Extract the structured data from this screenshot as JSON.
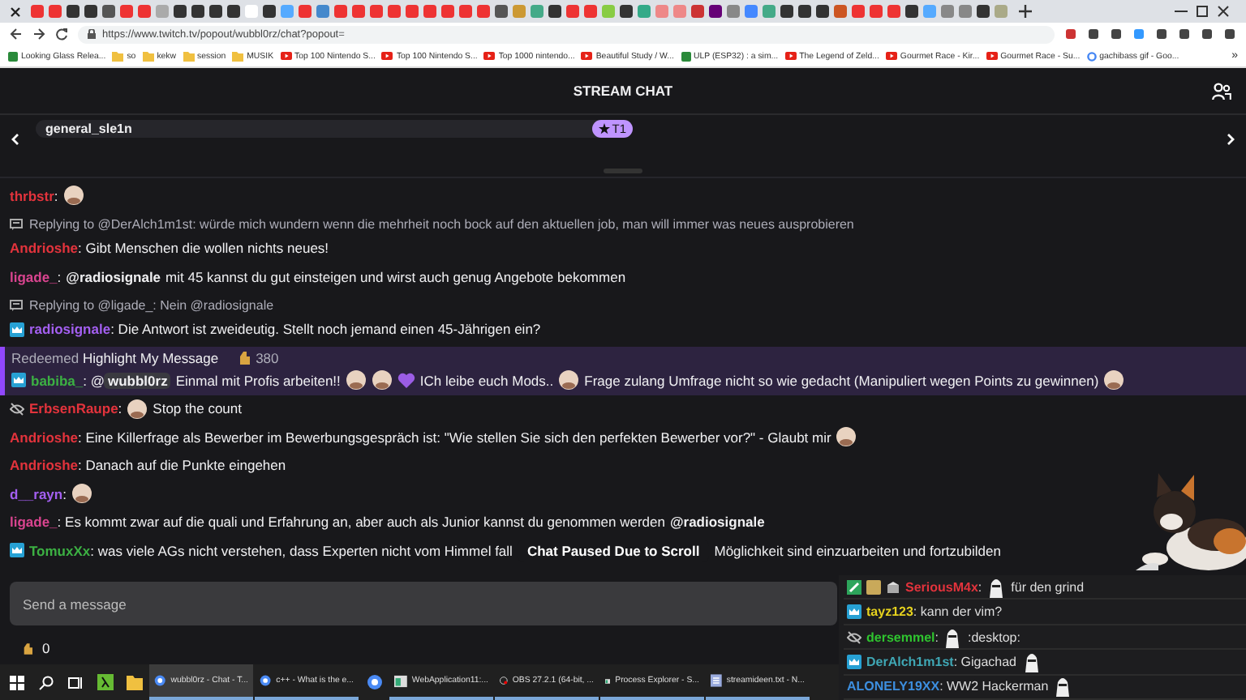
{
  "browser": {
    "url": "https://www.twitch.tv/popout/wubbl0rz/chat?popout=",
    "bookmarks": [
      {
        "label": "Looking Glass Relea...",
        "kind": "page"
      },
      {
        "label": "so",
        "kind": "folder"
      },
      {
        "label": "kekw",
        "kind": "folder"
      },
      {
        "label": "session",
        "kind": "folder"
      },
      {
        "label": "MUSIK",
        "kind": "folder"
      },
      {
        "label": "Top 100 Nintendo S...",
        "kind": "video"
      },
      {
        "label": "Top 100 Nintendo S...",
        "kind": "video"
      },
      {
        "label": "Top 1000 nintendo...",
        "kind": "video"
      },
      {
        "label": "Beautiful Study / W...",
        "kind": "video"
      },
      {
        "label": "ULP (ESP32) : a sim...",
        "kind": "page"
      },
      {
        "label": "The Legend of Zeld...",
        "kind": "video"
      },
      {
        "label": "Gourmet Race - Kir...",
        "kind": "video"
      },
      {
        "label": "Gourmet Race - Su...",
        "kind": "video"
      },
      {
        "label": "gachibass gif - Goo...",
        "kind": "search"
      }
    ],
    "more": "»"
  },
  "chat": {
    "title": "STREAM CHAT",
    "pinned": {
      "user": "general_sle1n",
      "badge": "T1"
    },
    "paused_banner": "Chat Paused Due to Scroll",
    "messages": [
      {
        "kind": "message",
        "user": "thrbstr",
        "color": "#e2333c",
        "parts": [
          {
            "kind": "text",
            "text": ":"
          },
          {
            "kind": "emote"
          }
        ]
      },
      {
        "kind": "reply",
        "text": "Replying to @DerAlch1m1st: würde mich wundern wenn die mehrheit noch bock auf den aktuellen job, man will immer was neues ausprobieren"
      },
      {
        "kind": "message",
        "user": "Andrioshe",
        "color": "#e2333c",
        "parts": [
          {
            "kind": "text",
            "text": ": Gibt Menschen die wollen nichts neues!"
          }
        ]
      },
      {
        "kind": "message",
        "user": "ligade_",
        "color": "#d9448f",
        "parts": [
          {
            "kind": "text",
            "text": ":"
          },
          {
            "kind": "mention",
            "text": "@radiosignale"
          },
          {
            "kind": "text",
            "text": "mit 45 kannst du gut einsteigen und wirst auch genug Angebote bekommen"
          }
        ]
      },
      {
        "kind": "reply",
        "text": "Replying to @ligade_: Nein @radiosignale"
      },
      {
        "kind": "message",
        "user": "radiosignale",
        "color": "#a35ff0",
        "badges": [
          {
            "kind": "sub"
          }
        ],
        "parts": [
          {
            "kind": "text",
            "text": ": Die Antwort ist zweideutig. Stellt noch jemand einen 45-Jährigen ein?"
          }
        ]
      },
      {
        "kind": "highlight",
        "reward": "Redeemed **Highlight My Message**",
        "cost": "380",
        "message": {
          "user": "babiba_",
          "color": "#3cb043",
          "badges": [
            {
              "kind": "sub"
            }
          ],
          "parts": [
            {
              "kind": "text",
              "text": ": @"
            },
            {
              "kind": "pill",
              "text": "wubbl0rz"
            },
            {
              "kind": "text",
              "text": "Einmal mit Profis arbeiten!!"
            },
            {
              "kind": "emote"
            },
            {
              "kind": "emote"
            },
            {
              "kind": "heart"
            },
            {
              "kind": "text",
              "text": "ICh leibe euch Mods.."
            },
            {
              "kind": "emote"
            },
            {
              "kind": "text",
              "text": "Frage zulang Umfrage nicht so wie gedacht (Manipuliert wegen Points zu gewinnen)"
            },
            {
              "kind": "emote"
            }
          ]
        }
      },
      {
        "kind": "message",
        "user": "ErbsenRaupe",
        "color": "#e2333c",
        "badges": [
          {
            "kind": "noeye"
          }
        ],
        "parts": [
          {
            "kind": "text",
            "text": ":"
          },
          {
            "kind": "emote"
          },
          {
            "kind": "text",
            "text": "Stop the count"
          }
        ]
      },
      {
        "kind": "message",
        "user": "Andrioshe",
        "color": "#e2333c",
        "parts": [
          {
            "kind": "text",
            "text": ": Eine Killerfrage als Bewerber im Bewerbungsgespräch ist: \"Wie stellen Sie sich den perfekten Bewerber vor?\" - Glaubt mir"
          },
          {
            "kind": "emote"
          }
        ]
      },
      {
        "kind": "message",
        "user": "Andrioshe",
        "color": "#e2333c",
        "parts": [
          {
            "kind": "text",
            "text": ": Danach auf die Punkte eingehen"
          }
        ]
      },
      {
        "kind": "message",
        "user": "d__rayn",
        "color": "#a35ff0",
        "parts": [
          {
            "kind": "text",
            "text": ":"
          },
          {
            "kind": "emote"
          }
        ]
      },
      {
        "kind": "message",
        "user": "ligade_",
        "color": "#d9448f",
        "parts": [
          {
            "kind": "text",
            "text": ": Es kommt zwar auf die quali und Erfahrung an, aber auch als Junior kannst du genommen werden"
          },
          {
            "kind": "mention",
            "text": "@radiosignale"
          }
        ]
      },
      {
        "kind": "message",
        "user": "TomuxXx",
        "color": "#3cb043",
        "badges": [
          {
            "kind": "sub"
          }
        ],
        "parts": [
          {
            "kind": "text",
            "text": ": was viele AGs nicht verstehen, dass Experten nicht vom Himmel fall"
          },
          {
            "kind": "banner"
          },
          {
            "kind": "text",
            "text": "Möglichkeit sind einzuarbeiten und fortzubilden"
          }
        ]
      }
    ],
    "input": {
      "placeholder": "Send a message"
    },
    "points": "0"
  },
  "overlay_chat": [
    {
      "user": "SeriousM4x",
      "color": "#e2333c",
      "badges": [
        {
          "kind": "turbo"
        },
        {
          "kind": "bits"
        },
        {
          "kind": "gift"
        }
      ],
      "parts": [
        {
          "kind": "text",
          "text": ":"
        },
        {
          "kind": "emote"
        },
        {
          "kind": "text",
          "text": "für den grind"
        }
      ]
    },
    {
      "user": "tayz123",
      "color": "#e6d21e",
      "badges": [
        {
          "kind": "sub"
        }
      ],
      "parts": [
        {
          "kind": "text",
          "text": ": kann der vim?"
        }
      ]
    },
    {
      "user": "dersemmel",
      "color": "#2fc42f",
      "badges": [
        {
          "kind": "noeye"
        }
      ],
      "parts": [
        {
          "kind": "text",
          "text": ":"
        },
        {
          "kind": "emote"
        },
        {
          "kind": "text",
          "text": ":desktop:"
        }
      ]
    },
    {
      "user": "DerAlch1m1st",
      "color": "#3fa7b5",
      "badges": [
        {
          "kind": "sub"
        }
      ],
      "parts": [
        {
          "kind": "text",
          "text": ": Gigachad"
        },
        {
          "kind": "emote"
        }
      ]
    },
    {
      "user": "ALONELY19XX",
      "color": "#3d8fe0",
      "parts": [
        {
          "kind": "text",
          "text": ": WW2 Hackerman"
        },
        {
          "kind": "emote"
        }
      ]
    }
  ],
  "taskbar": [
    {
      "kind": "start"
    },
    {
      "kind": "search"
    },
    {
      "kind": "taskview"
    },
    {
      "kind": "lambda"
    },
    {
      "kind": "folder"
    },
    {
      "kind": "chrome",
      "label": "wubbl0rz - Chat - T...",
      "selected": true
    },
    {
      "kind": "chrome",
      "label": "c++ - What is the e...",
      "selected": false
    },
    {
      "kind": "chrome"
    },
    {
      "kind": "window",
      "label": "WebApplication11:...",
      "selected": false
    },
    {
      "kind": "obs",
      "label": "OBS 27.2.1 (64-bit, ...",
      "selected": false
    },
    {
      "kind": "window",
      "label": "Process Explorer - S...",
      "selected": false
    },
    {
      "kind": "notepad",
      "label": "streamideen.txt - N...",
      "selected": false
    }
  ]
}
